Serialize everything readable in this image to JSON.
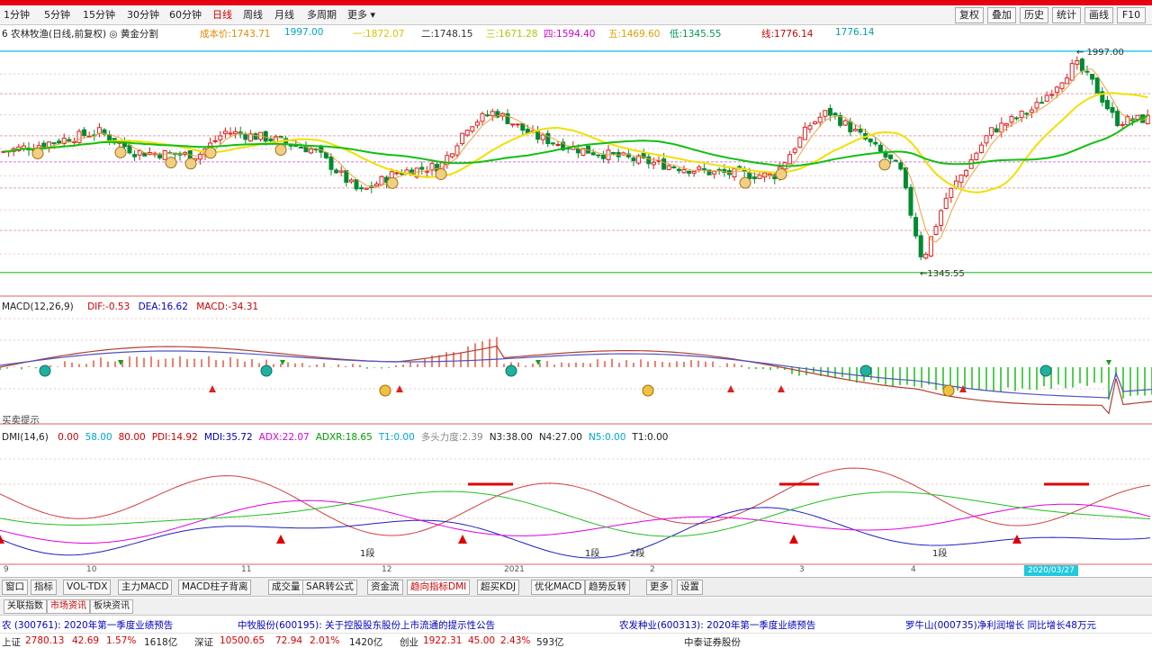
{
  "toolbar": {
    "periods": [
      "1分钟",
      "5分钟",
      "15分钟",
      "30分钟",
      "60分钟",
      "日线",
      "周线",
      "月线",
      "多周期",
      "更多"
    ],
    "active_period": "日线",
    "dropdown_label": "更多",
    "buttons": [
      "复权",
      "叠加",
      "历史",
      "统计",
      "画线",
      "F10"
    ]
  },
  "stockinfo": {
    "title": "6 农林牧渔(日线,前复权) ◎ 黄金分割",
    "items": [
      {
        "label": "成本价:1743.71",
        "color": "#e88a00"
      },
      {
        "label": "1997.00",
        "color": "#00a8c8"
      },
      {
        "label": "一:1872.07",
        "color": "#e0c000"
      },
      {
        "label": "二:1748.15",
        "color": "#333333"
      },
      {
        "label": "三:1671.28",
        "color": "#b0c800"
      },
      {
        "label": "四:1594.40",
        "color": "#d000d0"
      },
      {
        "label": "五:1469.60",
        "color": "#e0a000"
      },
      {
        "label": "低:1345.55",
        "color": "#009a50"
      },
      {
        "label": "线:1776.14",
        "color": "#d00000"
      },
      {
        "label": "1776.14",
        "color": "#00a0a0"
      }
    ]
  },
  "main_chart": {
    "high_label": "1997.00",
    "low_label": "1345.55",
    "fib_levels": [
      {
        "y": 1997.0,
        "color": "#00c0e0"
      },
      {
        "y": 1872.07,
        "color": "#e8a0a0"
      },
      {
        "y": 1748.15,
        "color": "#e8a0a0"
      },
      {
        "y": 1671.28,
        "color": "#e070e0"
      },
      {
        "y": 1594.4,
        "color": "#e8a0a0"
      },
      {
        "y": 1469.6,
        "color": "#e8a0a0"
      },
      {
        "y": 1345.55,
        "color": "#20c020"
      }
    ]
  },
  "macd": {
    "title": "MACD(12,26,9)",
    "dif": "DIF:-0.53",
    "dea": "DEA:16.62",
    "macd_val": "MACD:-34.31",
    "signal_label": "买卖提示",
    "colors": {
      "dif": "#b04030",
      "dea": "#5050c0",
      "pos": "#f08070",
      "neg": "#50d050"
    }
  },
  "dmi": {
    "title": "DMI(14,6)",
    "values": [
      {
        "label": "0.00",
        "color": "#d00000"
      },
      {
        "label": "58.00",
        "color": "#00a8d0"
      },
      {
        "label": "80.00",
        "color": "#d00000"
      },
      {
        "label": "PDI:14.92",
        "color": "#d00000"
      },
      {
        "label": "MDI:35.72",
        "color": "#0000c0"
      },
      {
        "label": "ADX:22.07",
        "color": "#e000e0"
      },
      {
        "label": "ADXR:18.65",
        "color": "#00a000"
      },
      {
        "label": "T1:0.00",
        "color": "#00a8d0"
      },
      {
        "label": "多头力度:2.39",
        "color": "#888888"
      },
      {
        "label": "N3:38.00",
        "color": "#222222"
      },
      {
        "label": "N4:27.00",
        "color": "#222222"
      },
      {
        "label": "N5:0.00",
        "color": "#00a8d0"
      },
      {
        "label": "T1:0.00",
        "color": "#222222"
      }
    ],
    "signals": [
      "1段",
      "1段",
      "2段",
      "1段"
    ]
  },
  "timeaxis": {
    "labels": [
      "9",
      "10",
      "11",
      "12",
      "2021",
      "2",
      "3",
      "4"
    ],
    "cursor_label": "2020/03/27"
  },
  "indicator_tabs": {
    "items": [
      "窗口",
      "指标",
      "VOL-TDX",
      "主力MACD",
      "MACD柱子背离",
      "成交量",
      "SAR转公式",
      "资金流",
      "趋向指标DMI",
      "超买KDJ",
      "优化MACD",
      "趋势反转",
      "更多",
      "设置"
    ],
    "active": "趋向指标DMI"
  },
  "news_tabs": {
    "items": [
      "关联指数",
      "市场资讯",
      "板块资讯"
    ],
    "active": "市场资讯"
  },
  "ticker": {
    "items": [
      {
        "text": "农  (300761): 2020年第一季度业绩预告",
        "color": "#0000c0"
      },
      {
        "text": "中牧股份(600195): 关于控股股东股份上市流通的提示性公告",
        "color": "#0000c0"
      },
      {
        "text": "农发种业(600313): 2020年第一季度业绩预告",
        "color": "#0000c0"
      },
      {
        "text": "罗牛山(000735)净利润增长 同比增长48万元",
        "color": "#0000c0"
      }
    ]
  },
  "statusbar": {
    "items": [
      {
        "text": "上证",
        "cls": ""
      },
      {
        "text": "2780.13",
        "cls": "up"
      },
      {
        "text": "42.69",
        "cls": "up"
      },
      {
        "text": "1.57%",
        "cls": "up"
      },
      {
        "text": "1618亿",
        "cls": ""
      },
      {
        "text": "深证",
        "cls": ""
      },
      {
        "text": "10500.65",
        "cls": "up"
      },
      {
        "text": "72.94",
        "cls": "up"
      },
      {
        "text": "2.01%",
        "cls": "up"
      },
      {
        "text": "1420亿",
        "cls": ""
      },
      {
        "text": "创业",
        "cls": ""
      },
      {
        "text": "1922.31",
        "cls": "up"
      },
      {
        "text": "45.00",
        "cls": "up"
      },
      {
        "text": "2.43%",
        "cls": "up"
      },
      {
        "text": "593亿",
        "cls": ""
      },
      {
        "text": "中泰证券股份",
        "cls": ""
      }
    ]
  }
}
